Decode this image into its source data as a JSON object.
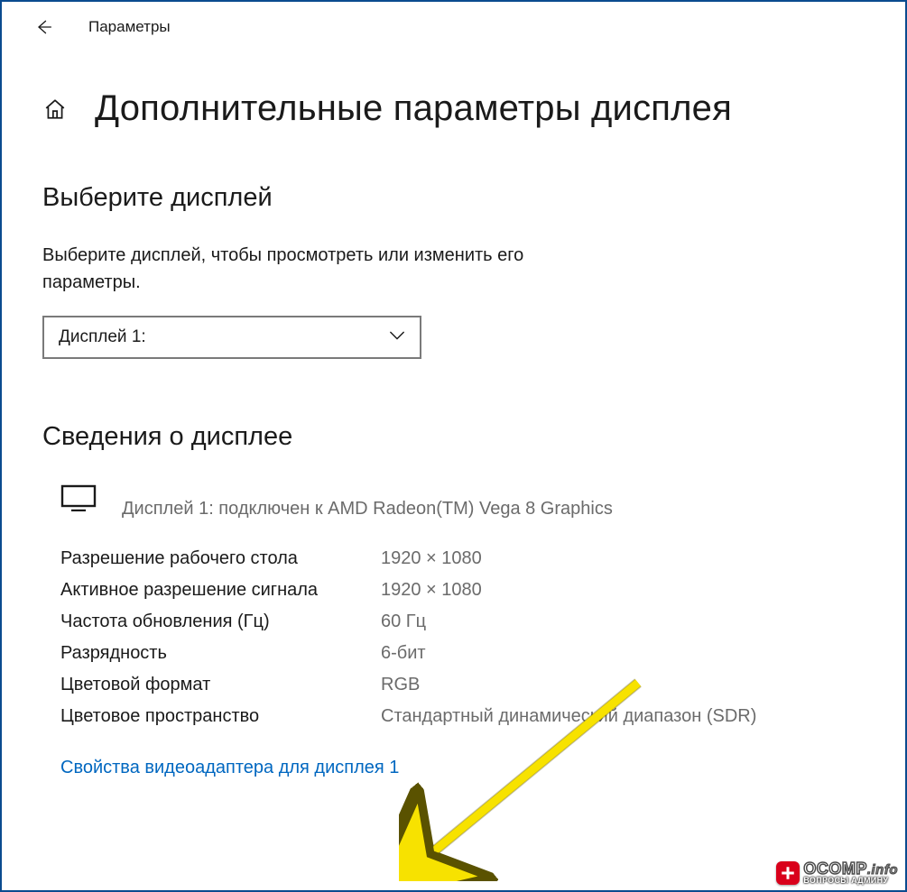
{
  "app": {
    "name": "Параметры"
  },
  "page": {
    "title": "Дополнительные параметры дисплея"
  },
  "select_section": {
    "heading": "Выберите дисплей",
    "description": "Выберите дисплей, чтобы просмотреть или изменить его параметры.",
    "dropdown_value": "Дисплей 1:"
  },
  "info_section": {
    "heading": "Сведения о дисплее",
    "connected_text": "Дисплей 1: подключен к AMD Radeon(TM) Vega 8 Graphics",
    "rows": [
      {
        "label": "Разрешение рабочего стола",
        "value": "1920 × 1080"
      },
      {
        "label": "Активное разрешение сигнала",
        "value": "1920 × 1080"
      },
      {
        "label": "Частота обновления (Гц)",
        "value": "60 Гц"
      },
      {
        "label": "Разрядность",
        "value": "6-бит"
      },
      {
        "label": "Цветовой формат",
        "value": "RGB"
      },
      {
        "label": "Цветовое пространство",
        "value": "Стандартный динамический диапазон (SDR)"
      }
    ],
    "adapter_link": "Свойства видеоадаптера для дисплея 1"
  },
  "watermark": {
    "main": "OCOMP",
    "suffix": ".info",
    "sub": "ВОПРОСЫ АДМИНУ"
  }
}
